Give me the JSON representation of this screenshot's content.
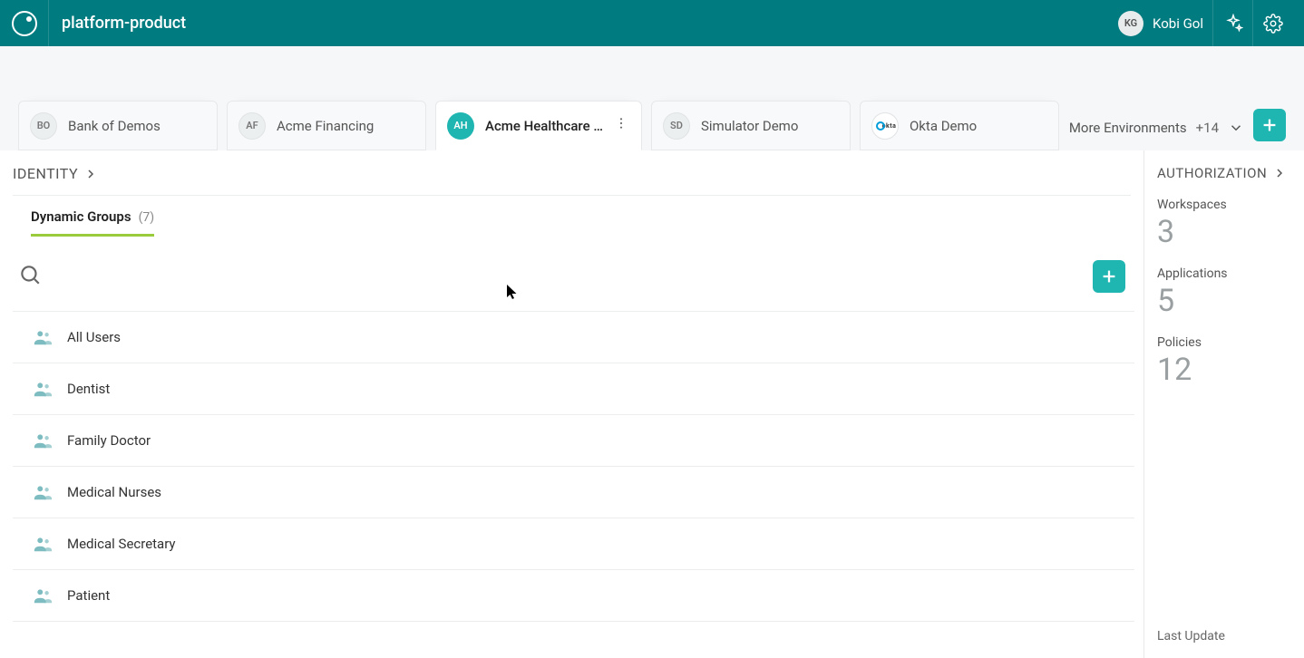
{
  "header": {
    "app_title": "platform-product",
    "user_initials": "KG",
    "user_name": "Kobi Gol"
  },
  "env": {
    "tabs": [
      {
        "badge": "BO",
        "name": "Bank of Demos"
      },
      {
        "badge": "AF",
        "name": "Acme Financing"
      },
      {
        "badge": "AH",
        "name": "Acme Healthcare …",
        "active": true
      },
      {
        "badge": "SD",
        "name": "Simulator Demo"
      },
      {
        "badge": "okta",
        "name": "Okta Demo",
        "okta": true
      }
    ],
    "more_label": "More Environments",
    "more_count": "+14"
  },
  "main": {
    "breadcrumb": "IDENTITY",
    "tab": {
      "label": "Dynamic Groups",
      "count": "(7)"
    },
    "groups": [
      "All Users",
      "Dentist",
      "Family Doctor",
      "Medical Nurses",
      "Medical Secretary",
      "Patient"
    ]
  },
  "side": {
    "heading": "AUTHORIZATION",
    "stats": {
      "workspaces_label": "Workspaces",
      "workspaces_value": "3",
      "applications_label": "Applications",
      "applications_value": "5",
      "policies_label": "Policies",
      "policies_value": "12"
    },
    "footer": "Last Update"
  }
}
